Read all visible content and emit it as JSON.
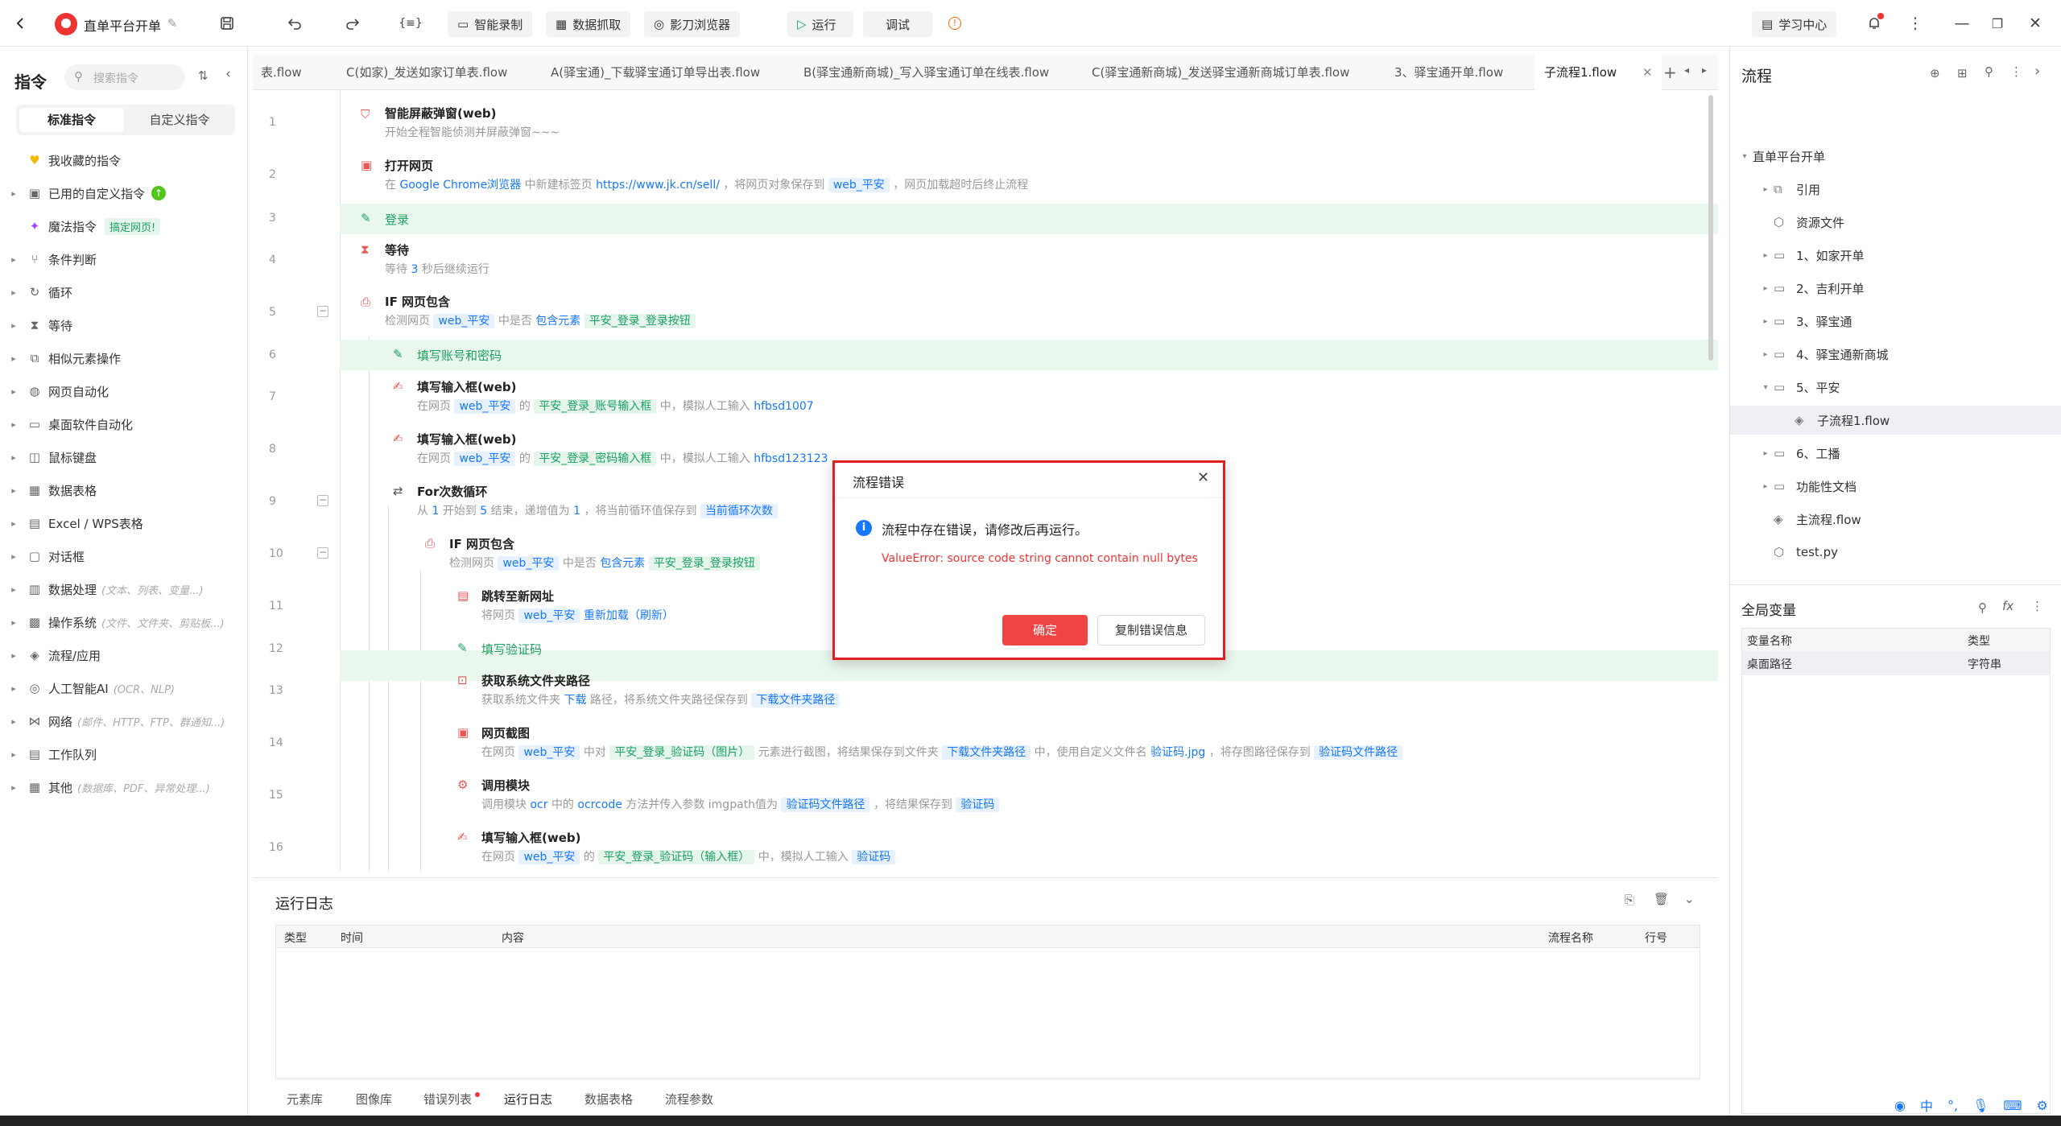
{
  "topbar": {
    "project_name": "直单平台开单",
    "btn_record": "智能录制",
    "btn_capture": "数据抓取",
    "btn_browser": "影刀浏览器",
    "btn_run": "运行",
    "btn_debug": "调试",
    "study_center": "学习中心"
  },
  "left": {
    "title": "指令",
    "search_placeholder": "搜索指令",
    "tab_standard": "标准指令",
    "tab_custom": "自定义指令",
    "items": [
      {
        "label": "我收藏的指令",
        "sub": ""
      },
      {
        "label": "已用的自定义指令",
        "sub": ""
      },
      {
        "label": "魔法指令",
        "sub": "",
        "badge": "搞定网页!"
      },
      {
        "label": "条件判断",
        "sub": ""
      },
      {
        "label": "循环",
        "sub": ""
      },
      {
        "label": "等待",
        "sub": ""
      },
      {
        "label": "相似元素操作",
        "sub": ""
      },
      {
        "label": "网页自动化",
        "sub": ""
      },
      {
        "label": "桌面软件自动化",
        "sub": ""
      },
      {
        "label": "鼠标键盘",
        "sub": ""
      },
      {
        "label": "数据表格",
        "sub": ""
      },
      {
        "label": "Excel / WPS表格",
        "sub": ""
      },
      {
        "label": "对话框",
        "sub": ""
      },
      {
        "label": "数据处理",
        "sub": "(文本、列表、变量...)"
      },
      {
        "label": "操作系统",
        "sub": "(文件、文件夹、剪贴板...)"
      },
      {
        "label": "流程/应用",
        "sub": ""
      },
      {
        "label": "人工智能AI",
        "sub": "(OCR、NLP)"
      },
      {
        "label": "网络",
        "sub": "(邮件、HTTP、FTP、群通知...)"
      },
      {
        "label": "工作队列",
        "sub": ""
      },
      {
        "label": "其他",
        "sub": "(数据库、PDF、异常处理...)"
      }
    ]
  },
  "tabs": [
    "表.flow",
    "C(如家)_发送如家订单表.flow",
    "A(驿宝通)_下载驿宝通订单导出表.flow",
    "B(驿宝通新商城)_写入驿宝通订单在线表.flow",
    "C(驿宝通新商城)_发送驿宝通新商城订单表.flow",
    "3、驿宝通开单.flow",
    "子流程1.flow"
  ],
  "steps": {
    "s1": {
      "n": "1",
      "t": "智能屏蔽弹窗(web)",
      "d": "开始全程智能侦测并屏蔽弹窗~~~"
    },
    "s2": {
      "n": "2",
      "t": "打开网页",
      "d1": "在",
      "b1": "Google Chrome浏览器",
      "d2": "中新建标签页",
      "b2": "https://www.jk.cn/sell/",
      "d3": "，将网页对象保存到",
      "v1": "web_平安",
      "d4": "，网页加载超时后终止流程"
    },
    "s3": {
      "n": "3",
      "t": "登录"
    },
    "s4": {
      "n": "4",
      "t": "等待",
      "d1": "等待",
      "b1": "3",
      "d2": "秒后继续运行"
    },
    "s5": {
      "n": "5",
      "t": "IF 网页包含",
      "d1": "检测网页",
      "v1": "web_平安",
      "d2": "中是否",
      "b1": "包含元素",
      "g1": "平安_登录_登录按钮"
    },
    "s6": {
      "n": "6",
      "t": "填写账号和密码"
    },
    "s7": {
      "n": "7",
      "t": "填写输入框(web)",
      "d1": "在网页",
      "v1": "web_平安",
      "d2": "的",
      "g1": "平安_登录_账号输入框",
      "d3": "中，模拟人工输入",
      "b1": "hfbsd1007"
    },
    "s8": {
      "n": "8",
      "t": "填写输入框(web)",
      "d1": "在网页",
      "v1": "web_平安",
      "d2": "的",
      "g1": "平安_登录_密码输入框",
      "d3": "中，模拟人工输入",
      "b1": "hfbsd123123"
    },
    "s9": {
      "n": "9",
      "t": "For次数循环",
      "d1": "从",
      "b1": "1",
      "d2": "开始到",
      "b2": "5",
      "d3": "结束，递增值为",
      "b3": "1",
      "d4": "，将当前循环值保存到",
      "v1": "当前循环次数"
    },
    "s10": {
      "n": "10",
      "t": "IF 网页包含",
      "d1": "检测网页",
      "v1": "web_平安",
      "d2": "中是否",
      "b1": "包含元素",
      "g1": "平安_登录_登录按钮"
    },
    "s11": {
      "n": "11",
      "t": "跳转至新网址",
      "d1": "将网页",
      "v1": "web_平安",
      "b1": "重新加载（刷新）"
    },
    "s12": {
      "n": "12",
      "t": "填写验证码"
    },
    "s13": {
      "n": "13",
      "t": "获取系统文件夹路径",
      "d1": "获取系统文件夹",
      "b1": "下载",
      "d2": "路径，将系统文件夹路径保存到",
      "v1": "下载文件夹路径"
    },
    "s14": {
      "n": "14",
      "t": "网页截图",
      "d1": "在网页",
      "v1": "web_平安",
      "d2": "中对",
      "g1": "平安_登录_验证码（图片）",
      "d3": "元素进行截图，将结果保存到文件夹",
      "v2": "下载文件夹路径",
      "d4": "中，使用自定义文件名",
      "b1": "验证码.jpg",
      "d5": "，将存图路径保存到",
      "v3": "验证码文件路径"
    },
    "s15": {
      "n": "15",
      "t": "调用模块",
      "d1": "调用模块",
      "b1": "ocr",
      "d2": "中的",
      "b2": "ocrcode",
      "d3": "方法并传入参数 imgpath值为",
      "v1": "验证码文件路径",
      "d4": "，将结果保存到",
      "v2": "验证码"
    },
    "s16": {
      "n": "16",
      "t": "填写输入框(web)",
      "d1": "在网页",
      "v1": "web_平安",
      "d2": "的",
      "g1": "平安_登录_验证码（输入框）",
      "d3": "中，模拟人工输入",
      "v2": "验证码"
    }
  },
  "log": {
    "title": "运行日志",
    "cols": [
      "类型",
      "时间",
      "内容",
      "流程名称",
      "行号"
    ],
    "bottom_tabs": [
      "元素库",
      "图像库",
      "错误列表",
      "运行日志",
      "数据表格",
      "流程参数"
    ]
  },
  "right": {
    "title": "流程",
    "tree": [
      "直单平台开单",
      "引用",
      "资源文件",
      "1、如家开单",
      "2、吉利开单",
      "3、驿宝通",
      "4、驿宝通新商城",
      "5、平安",
      "子流程1.flow",
      "6、工播",
      "功能性文档",
      "主流程.flow",
      "test.py"
    ],
    "vars_title": "全局变量",
    "vars_cols": [
      "变量名称",
      "类型"
    ],
    "vars_rows": [
      [
        "桌面路径",
        "字符串"
      ]
    ]
  },
  "dialog": {
    "title": "流程错误",
    "message": "流程中存在错误，请修改后再运行。",
    "error": "ValueError: source code string cannot contain null bytes",
    "ok": "确定",
    "copy": "复制错误信息"
  },
  "ime": {
    "zh": "中"
  }
}
